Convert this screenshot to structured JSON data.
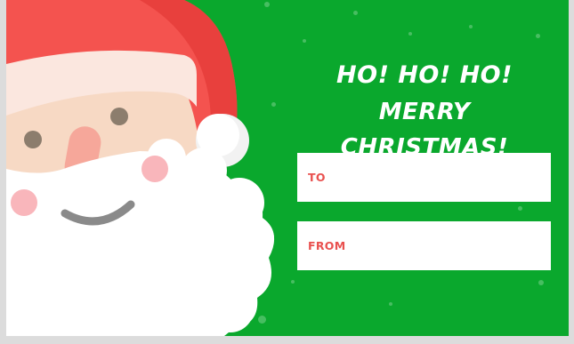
{
  "card": {
    "greeting_line1": "HO! HO! HO!",
    "greeting_line2": "MERRY CHRISTMAS!",
    "to_label": "TO",
    "from_label": "FROM"
  },
  "colors": {
    "background": "#0aa82d",
    "hat_red": "#f4534f",
    "beard_white": "#ffffff",
    "skin": "#f7d9c4",
    "label_red": "#e9514f"
  },
  "icons": [
    "santa-illustration"
  ]
}
